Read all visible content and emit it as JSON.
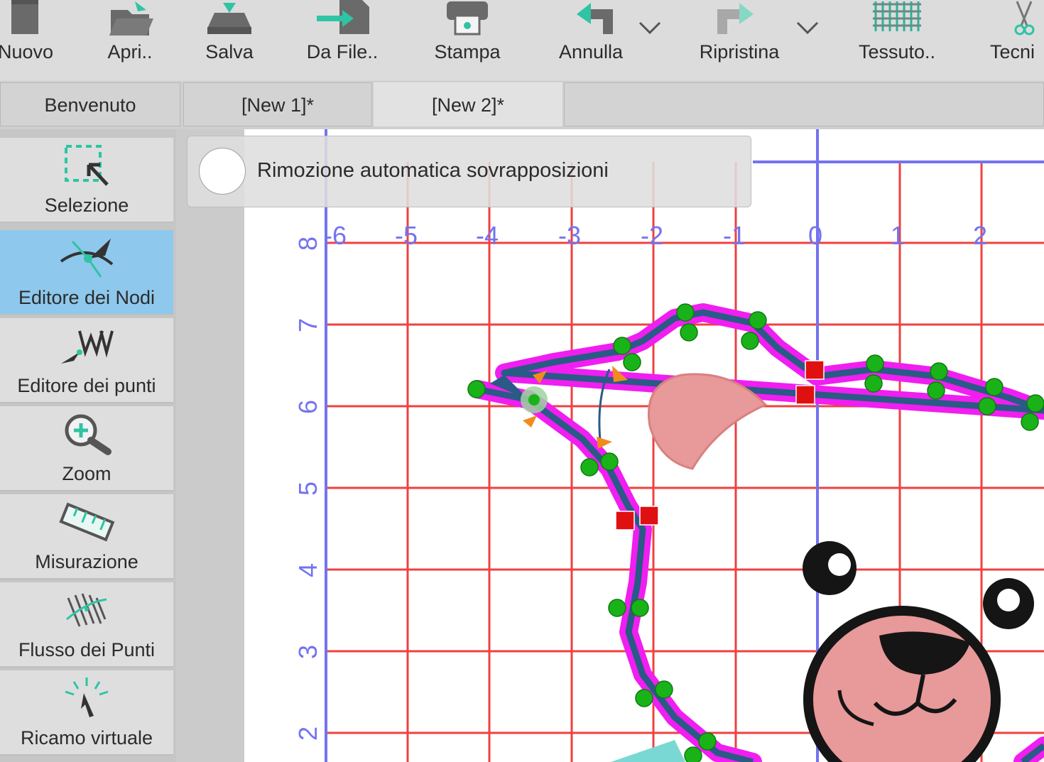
{
  "toolbar": {
    "buttons": [
      {
        "label": "Nuovo",
        "icon": "new-file-icon"
      },
      {
        "label": "Apri..",
        "icon": "open-folder-icon"
      },
      {
        "label": "Salva",
        "icon": "save-drive-icon"
      },
      {
        "label": "Da File..",
        "icon": "import-from-file-icon"
      },
      {
        "label": "Stampa",
        "icon": "printer-icon"
      },
      {
        "label": "Annulla",
        "icon": "undo-icon"
      },
      {
        "label": "Ripristina",
        "icon": "redo-icon"
      },
      {
        "label": "Tessuto..",
        "icon": "fabric-icon"
      },
      {
        "label": "Tecni",
        "icon": "scissors-icon"
      }
    ]
  },
  "tabs": [
    {
      "label": "Benvenuto",
      "active": false
    },
    {
      "label": "[New 1]*",
      "active": false
    },
    {
      "label": "[New 2]*",
      "active": true
    }
  ],
  "tools": [
    {
      "label": "Selezione",
      "icon": "selection-icon",
      "active": false
    },
    {
      "label": "Editore dei Nodi",
      "icon": "node-editor-icon",
      "active": true
    },
    {
      "label": "Editore dei punti",
      "icon": "stitch-editor-icon",
      "active": false
    },
    {
      "label": "Zoom",
      "icon": "zoom-icon",
      "active": false
    },
    {
      "label": "Misurazione",
      "icon": "ruler-icon",
      "active": false
    },
    {
      "label": "Flusso dei Punti",
      "icon": "stitch-flow-icon",
      "active": false
    },
    {
      "label": "Ricamo virtuale",
      "icon": "virtual-embroidery-icon",
      "active": false
    }
  ],
  "option": {
    "label": "Rimozione automatica sovrapposizioni",
    "checked": false
  },
  "canvas": {
    "x_ruler": [
      "-6",
      "-5",
      "-4",
      "-3",
      "-2",
      "-1",
      "0",
      "1",
      "2"
    ],
    "y_ruler": [
      "8",
      "7",
      "6",
      "5",
      "4",
      "3",
      "2"
    ],
    "colors": {
      "grid": "#f04040",
      "axis": "#7373f0",
      "outline": "#f01ef0",
      "stitch": "#2a5a86",
      "node": "#19b319",
      "corner_node": "#e01010",
      "handle": "#f08c1e",
      "felt": "#e8999a"
    }
  }
}
